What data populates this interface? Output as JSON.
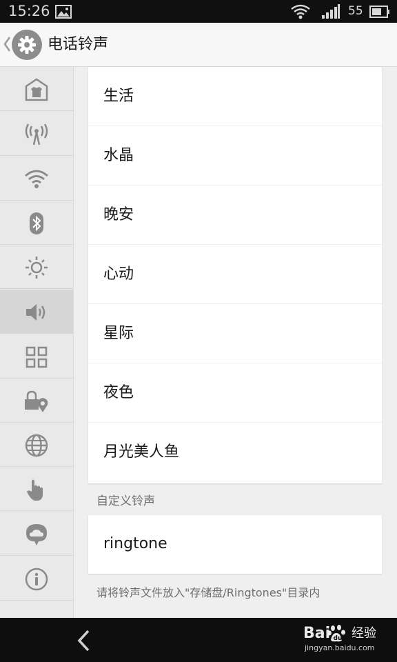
{
  "status_bar": {
    "time": "15:26",
    "battery_level": "55",
    "icons": [
      "image-icon",
      "wifi-icon",
      "signal-icon",
      "battery-icon"
    ]
  },
  "action_bar": {
    "title": "电话铃声",
    "icons": [
      "back-chevron-icon",
      "settings-gear-icon"
    ]
  },
  "sidebar": {
    "items": [
      {
        "icon": "home-theme-icon"
      },
      {
        "icon": "mobile-network-icon"
      },
      {
        "icon": "wifi-icon"
      },
      {
        "icon": "bluetooth-icon"
      },
      {
        "icon": "brightness-icon"
      },
      {
        "icon": "sound-icon",
        "active": true
      },
      {
        "icon": "apps-grid-icon"
      },
      {
        "icon": "lock-location-icon"
      },
      {
        "icon": "globe-icon"
      },
      {
        "icon": "gesture-hand-icon"
      },
      {
        "icon": "cloud-icon"
      },
      {
        "icon": "info-icon"
      }
    ]
  },
  "ringtones": {
    "items": [
      "生活",
      "水晶",
      "晚安",
      "心动",
      "星际",
      "夜色",
      "月光美人鱼"
    ]
  },
  "custom": {
    "header": "自定义铃声",
    "items": [
      "ringtone"
    ],
    "hint": "请将铃声文件放入\"存储盘/Ringtones\"目录内"
  },
  "nav_bar": {
    "icons": [
      "back-icon"
    ]
  },
  "watermark": {
    "logo_text": "Bai",
    "logo_cn": "经验",
    "url": "jingyan.baidu.com"
  },
  "colors": {
    "status_bar_bg": "#101010",
    "action_bar_bg": "#f7f7f7",
    "sidebar_bg": "#e9e9e9",
    "sidebar_active_bg": "#d6d6d6",
    "card_bg": "#ffffff",
    "gear_circle": "#8c8c8c",
    "nav_bar_bg": "#0e0e0e"
  }
}
